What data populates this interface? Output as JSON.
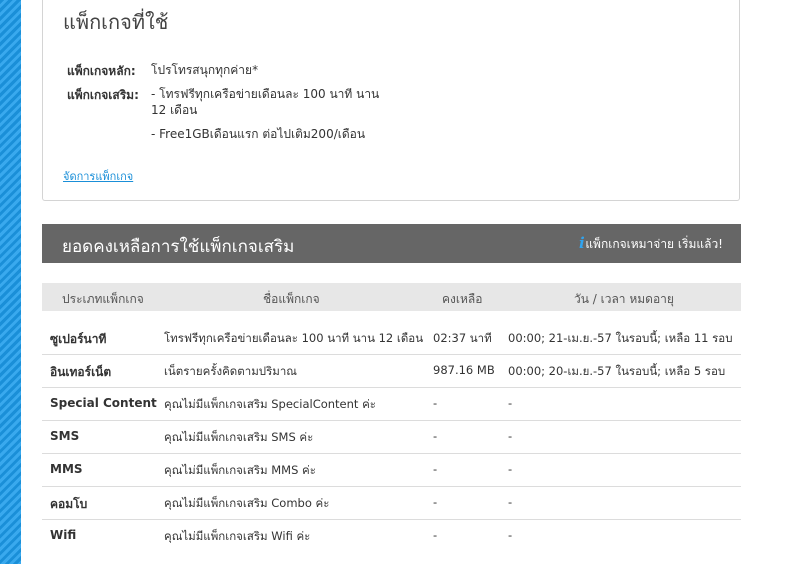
{
  "package_section": {
    "title": "แพ็กเกจที่ใช้",
    "main_label": "แพ็กเกจหลัก:",
    "main_value": "โปรโทรสนุกทุกค่าย*",
    "extra_label": "แพ็กเกจเสริม:",
    "extra_values": [
      "- โทรฟรีทุกเครือข่ายเดือนละ 100 นาที นาน 12 เดือน",
      "- Free1GBเดือนแรก ต่อไปเติม200/เดือน"
    ],
    "manage_link": "จัดการแพ็กเกจ"
  },
  "balance_section": {
    "title": "ยอดคงเหลือการใช้แพ็กเกจเสริม",
    "note": "แพ็กเกจเหมาจ่าย เริ่มแล้ว!",
    "columns": [
      "ประเภทแพ็กเกจ",
      "ชื่อแพ็กเกจ",
      "คงเหลือ",
      "วัน / เวลา หมดอายุ"
    ],
    "rows": [
      {
        "type": "ซูเปอร์นาที",
        "name": "โทรฟรีทุกเครือข่ายเดือนละ 100 นาที นาน 12 เดือน",
        "remain": "02:37 นาที",
        "expire": "00:00; 21-เม.ย.-57 ในรอบนี้; เหลือ 11 รอบ"
      },
      {
        "type": "อินเทอร์เน็ต",
        "name": "เน็ตรายครั้งคิดตามปริมาณ",
        "remain": "987.16 MB",
        "expire": "00:00; 20-เม.ย.-57 ในรอบนี้; เหลือ 5 รอบ"
      },
      {
        "type": "Special Content",
        "name": "คุณไม่มีแพ็กเกจเสริม SpecialContent ค่ะ",
        "remain": "-",
        "expire": "-"
      },
      {
        "type": "SMS",
        "name": "คุณไม่มีแพ็กเกจเสริม SMS ค่ะ",
        "remain": "-",
        "expire": "-"
      },
      {
        "type": "MMS",
        "name": "คุณไม่มีแพ็กเกจเสริม MMS ค่ะ",
        "remain": "-",
        "expire": "-"
      },
      {
        "type": "คอมโบ",
        "name": "คุณไม่มีแพ็กเกจเสริม Combo ค่ะ",
        "remain": "-",
        "expire": "-"
      },
      {
        "type": "Wifi",
        "name": "คุณไม่มีแพ็กเกจเสริม Wifi ค่ะ",
        "remain": "-",
        "expire": "-"
      }
    ]
  },
  "colors": {
    "accent": "#1a8fd8",
    "header_bg": "#666666",
    "col_head_bg": "#e7e7e7"
  }
}
